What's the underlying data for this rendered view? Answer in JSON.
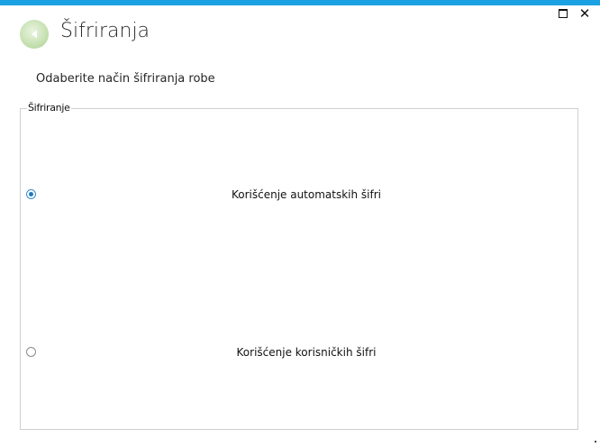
{
  "window": {
    "accent_color": "#1ba1e2",
    "maximize_icon": "maximize-icon",
    "close_label": "✕"
  },
  "header": {
    "back_icon": "back-arrow-icon",
    "title": "Šifriranja"
  },
  "subtitle": "Odaberite način šifriranja robe",
  "group": {
    "legend": "Šifriranje",
    "options": [
      {
        "label": "Korišćenje automatskih šifri",
        "selected": true
      },
      {
        "label": "Korišćenje korisničkih šifri",
        "selected": false
      }
    ]
  }
}
